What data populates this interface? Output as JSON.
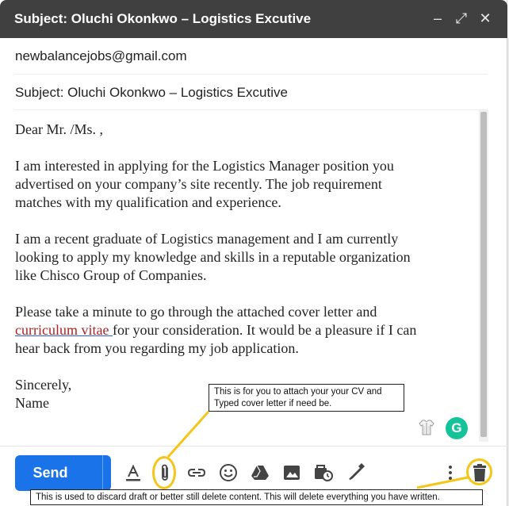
{
  "window": {
    "title": "Subject: Oluchi Okonkwo – Logistics Excutive",
    "minimize_symbol": "–",
    "maximize_symbol": "⤢",
    "close_symbol": "✕"
  },
  "fields": {
    "to": "newbalancejobs@gmail.com",
    "subject": "Subject: Oluchi Okonkwo – Logistics Excutive"
  },
  "body": {
    "greeting": "Dear Mr. /Ms. ,",
    "para1_line1": "I am interested in applying for the Logistics Manager position you",
    "para1_line2": "advertised on your company’s site recently. The job requirement",
    "para1_line3": "matches with my qualification and experience.",
    "para2_line1": "I am a recent graduate of Logistics management and I am currently",
    "para2_line2": "looking to apply my knowledge and skills in a reputable organization",
    "para2_line3": "like Chisco Group of Companies.",
    "para3_line1": "Please take a minute to go through the attached cover letter and",
    "para3_link": "curriculum vitae ",
    "para3_line2_rest": "for your consideration. It would be a pleasure if I can",
    "para3_line3": "hear back from you regarding my job application.",
    "closing": "Sincerely,",
    "signature": "Name"
  },
  "toolbar": {
    "send_label": "Send",
    "send_options_symbol": "▼",
    "grammarly_letter": "G",
    "icons": [
      "format-text-icon",
      "attach-icon",
      "link-icon",
      "emoji-icon",
      "drive-icon",
      "photo-icon",
      "confidential-mode-icon",
      "signature-icon",
      "more-options-icon",
      "trash-icon"
    ]
  },
  "annotations": {
    "attach_callout": "This is for you to attach your your CV and Typed cover letter if need be.",
    "discard_callout": "This is used to discard draft or better still delete content. This will delete everything you have written.",
    "highlight_color": "#f5c518"
  },
  "colors": {
    "titlebar": "#404040",
    "send_button": "#1a73e8",
    "grammarly": "#15c39a"
  }
}
